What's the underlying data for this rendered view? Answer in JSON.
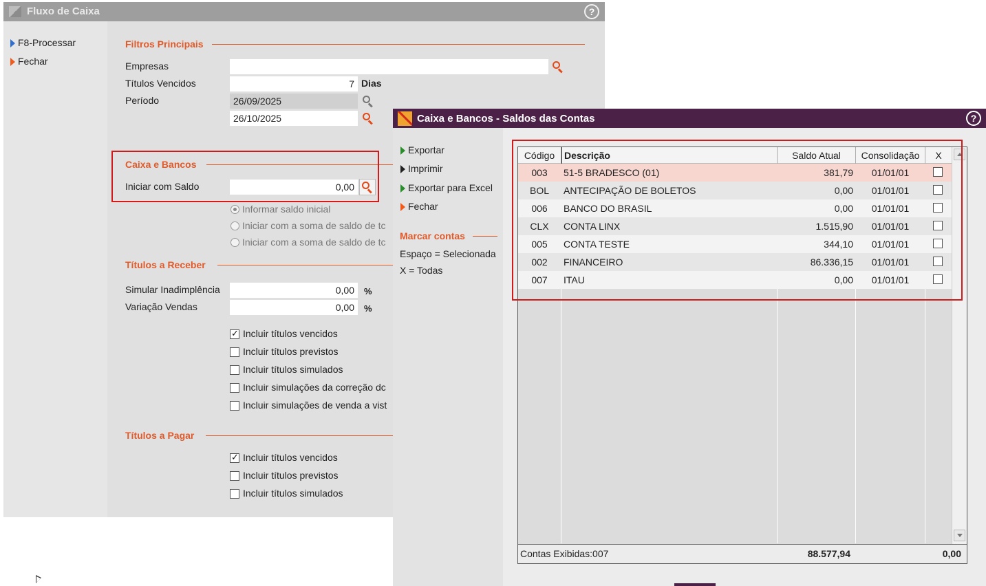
{
  "fluxo": {
    "title": "Fluxo de Caixa",
    "help": "?",
    "sidebar": {
      "processar": "F8-Processar",
      "fechar": "Fechar"
    },
    "filtros": {
      "title": "Filtros Principais",
      "empresas_label": "Empresas",
      "empresas_value": "",
      "titulos_vencidos_label": "Títulos Vencidos",
      "titulos_vencidos_value": "7",
      "dias": "Dias",
      "periodo_label": "Período",
      "periodo_inicio": "26/09/2025",
      "periodo_fim": "26/10/2025"
    },
    "caixa": {
      "title": "Caixa e Bancos",
      "iniciar_label": "Iniciar com Saldo",
      "iniciar_value": "0,00",
      "radios": [
        "Informar saldo inicial",
        "Iniciar com a soma de saldo de tc",
        "Iniciar com a soma de saldo de tc"
      ]
    },
    "receber": {
      "title": "Títulos a Receber",
      "simular_label": "Simular Inadimplência",
      "simular_value": "0,00",
      "variacao_label": "Variação Vendas",
      "variacao_value": "0,00",
      "percent": "%",
      "checks": [
        {
          "label": "Incluir títulos vencidos",
          "checked": true
        },
        {
          "label": "Incluir títulos previstos",
          "checked": false
        },
        {
          "label": "Incluir títulos simulados",
          "checked": false
        },
        {
          "label": "Incluir simulações da correção dc",
          "checked": false
        },
        {
          "label": "Incluir simulações de venda a vist",
          "checked": false
        }
      ]
    },
    "pagar": {
      "title": "Títulos a Pagar",
      "checks": [
        {
          "label": "Incluir títulos vencidos",
          "checked": true
        },
        {
          "label": "Incluir títulos previstos",
          "checked": false
        },
        {
          "label": "Incluir títulos simulados",
          "checked": false
        }
      ]
    }
  },
  "saldos": {
    "title": "Caixa e Bancos - Saldos das Contas",
    "help": "?",
    "sidebar": {
      "exportar": "Exportar",
      "imprimir": "Imprimir",
      "exportar_excel": "Exportar para Excel",
      "fechar": "Fechar",
      "marcar_title": "Marcar contas",
      "espaco": "Espaço = Selecionada",
      "todas": "X = Todas"
    },
    "columns": [
      "Código",
      "Descrição",
      "Saldo Atual",
      "Consolidação",
      "X"
    ],
    "rows": [
      {
        "codigo": "003",
        "descricao": "51-5 BRADESCO (01)",
        "saldo": "381,79",
        "consolidacao": "01/01/01",
        "checked": false
      },
      {
        "codigo": "BOL",
        "descricao": "ANTECIPAÇÃO DE BOLETOS",
        "saldo": "0,00",
        "consolidacao": "01/01/01",
        "checked": false
      },
      {
        "codigo": "006",
        "descricao": "BANCO DO BRASIL",
        "saldo": "0,00",
        "consolidacao": "01/01/01",
        "checked": false
      },
      {
        "codigo": "CLX",
        "descricao": "CONTA LINX",
        "saldo": "1.515,90",
        "consolidacao": "01/01/01",
        "checked": false
      },
      {
        "codigo": "005",
        "descricao": "CONTA TESTE",
        "saldo": "344,10",
        "consolidacao": "01/01/01",
        "checked": false
      },
      {
        "codigo": "002",
        "descricao": "FINANCEIRO",
        "saldo": "86.336,15",
        "consolidacao": "01/01/01",
        "checked": false
      },
      {
        "codigo": "007",
        "descricao": "ITAU",
        "saldo": "0,00",
        "consolidacao": "01/01/01",
        "checked": false
      }
    ],
    "footer": {
      "contas": "Contas Exibidas:007",
      "total": "88.577,94",
      "x_total": "0,00"
    }
  },
  "colors": {
    "accent": "#e05a2a",
    "title_purple": "#4b2147",
    "highlight_row": "#f7d6d0",
    "annotation_red": "#d11a1a"
  }
}
